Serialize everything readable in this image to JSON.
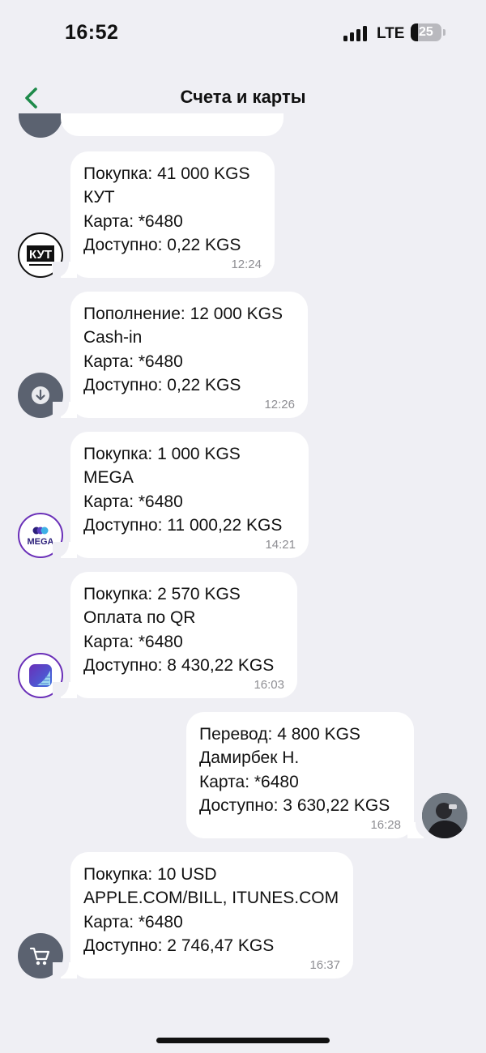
{
  "status_bar": {
    "time": "16:52",
    "network": "LTE",
    "battery": "25"
  },
  "nav": {
    "title": "Счета и карты"
  },
  "messages": [
    {
      "avatar": "kut-logo",
      "logo_text": "КУТ",
      "lines": [
        "Покупка: 41 000 KGS",
        "КУТ",
        "Карта: *6480",
        "Доступно: 0,22 KGS"
      ],
      "time": "12:24"
    },
    {
      "avatar": "arrow-down-icon",
      "lines": [
        "Пополнение: 12 000 KGS",
        "Cash-in",
        "Карта: *6480",
        "Доступно: 0,22 KGS"
      ],
      "time": "12:26"
    },
    {
      "avatar": "mega-logo",
      "logo_text": "MEGA",
      "lines": [
        "Покупка: 1 000 KGS",
        "MEGA",
        "Карта: *6480",
        "Доступно: 11 000,22 KGS"
      ],
      "time": "14:21"
    },
    {
      "avatar": "qr-payment-logo",
      "lines": [
        "Покупка: 2 570 KGS",
        "Оплата по QR",
        "Карта: *6480",
        "Доступно: 8 430,22 KGS"
      ],
      "time": "16:03"
    },
    {
      "avatar": "contact-photo",
      "lines": [
        "Перевод: 4 800 KGS",
        "Дамирбек Н.",
        "Карта: *6480",
        "Доступно: 3 630,22 KGS"
      ],
      "time": "16:28"
    },
    {
      "avatar": "cart-icon",
      "lines": [
        "Покупка: 10 USD",
        "APPLE.COM/BILL, ITUNES.COM",
        "Карта: *6480",
        "Доступно: 2 746,47 KGS"
      ],
      "time": "16:37"
    }
  ],
  "colors": {
    "accent": "#1e8a4a",
    "background": "#efeff4",
    "bubble": "#ffffff",
    "avatar_gray": "#5b6270",
    "mega_purple": "#6a2fb8",
    "time_gray": "#8e8e93"
  }
}
